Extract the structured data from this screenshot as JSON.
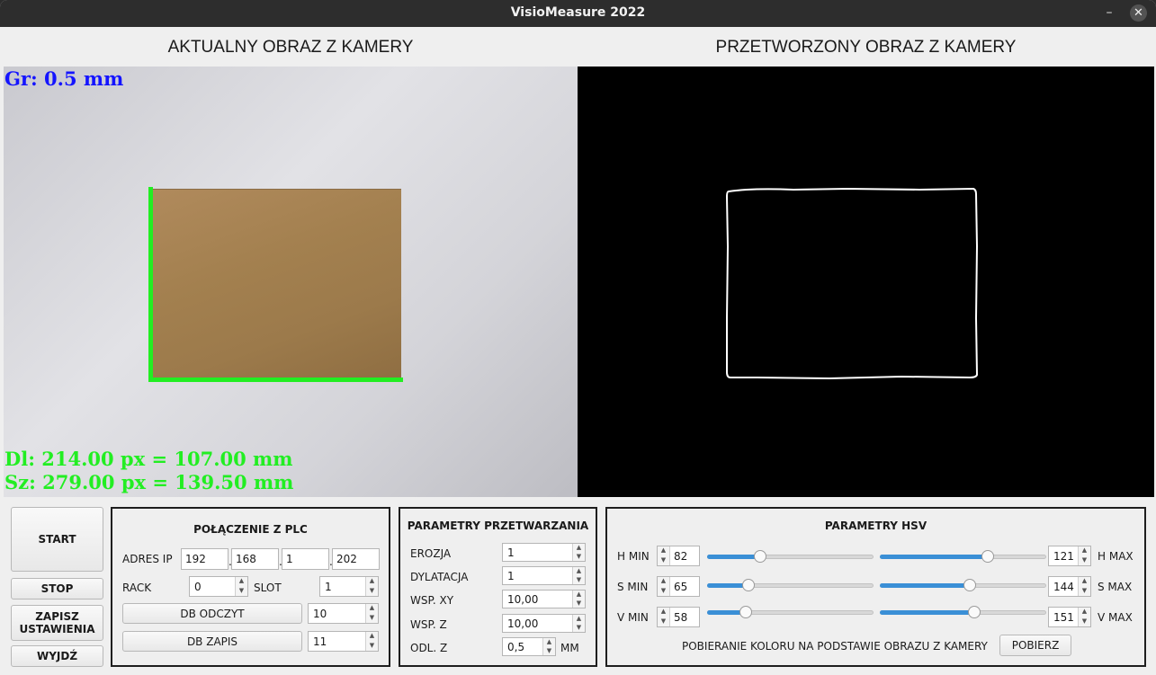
{
  "window": {
    "title": "VisioMeasure 2022"
  },
  "headers": {
    "live": "AKTUALNY OBRAZ Z KAMERY",
    "processed": "PRZETWORZONY OBRAZ Z KAMERY"
  },
  "overlay": {
    "gr": "Gr: 0.5 mm",
    "dl": "Dl: 214.00 px = 107.00 mm",
    "sz": "Sz: 279.00 px = 139.50 mm",
    "colors": {
      "gr": "#1414ff",
      "measure": "#22ee22"
    }
  },
  "controls": {
    "start": "START",
    "stop": "STOP",
    "save": "ZAPISZ USTAWIENIA",
    "exit": "WYJDŹ"
  },
  "plc": {
    "title": "POŁĄCZENIE Z PLC",
    "ip_label": "ADRES IP",
    "ip": [
      "192",
      "168",
      "1",
      "202"
    ],
    "rack_label": "RACK",
    "rack": "0",
    "slot_label": "SLOT",
    "slot": "1",
    "db_read_label": "DB ODCZYT",
    "db_read": "10",
    "db_write_label": "DB ZAPIS",
    "db_write": "11"
  },
  "processing": {
    "title": "PARAMETRY PRZETWARZANIA",
    "erosion_label": "EROZJA",
    "erosion": "1",
    "dilation_label": "DYLATACJA",
    "dilation": "1",
    "wsp_xy_label": "WSP. XY",
    "wsp_xy": "10,00",
    "wsp_z_label": "WSP. Z",
    "wsp_z": "10,00",
    "odl_z_label": "ODL. Z",
    "odl_z": "0,5",
    "odl_z_unit": "MM"
  },
  "hsv": {
    "title": "PARAMETRY HSV",
    "h_min_label": "H MIN",
    "h_min": "82",
    "h_min_level": 0.32,
    "h_max_label": "H MAX",
    "h_max": "121",
    "h_max_level": 0.65,
    "s_min_label": "S MIN",
    "s_min": "65",
    "s_min_level": 0.25,
    "s_max_label": "S MAX",
    "s_max": "144",
    "s_max_level": 0.54,
    "v_min_label": "V MIN",
    "v_min": "58",
    "v_min_level": 0.23,
    "v_max_label": "V MAX",
    "v_max": "151",
    "v_max_level": 0.57,
    "pick_label": "POBIERANIE KOLORU NA PODSTAWIE OBRAZU Z KAMERY",
    "pick_button": "POBIERZ",
    "accent": "#3a8fd6"
  }
}
